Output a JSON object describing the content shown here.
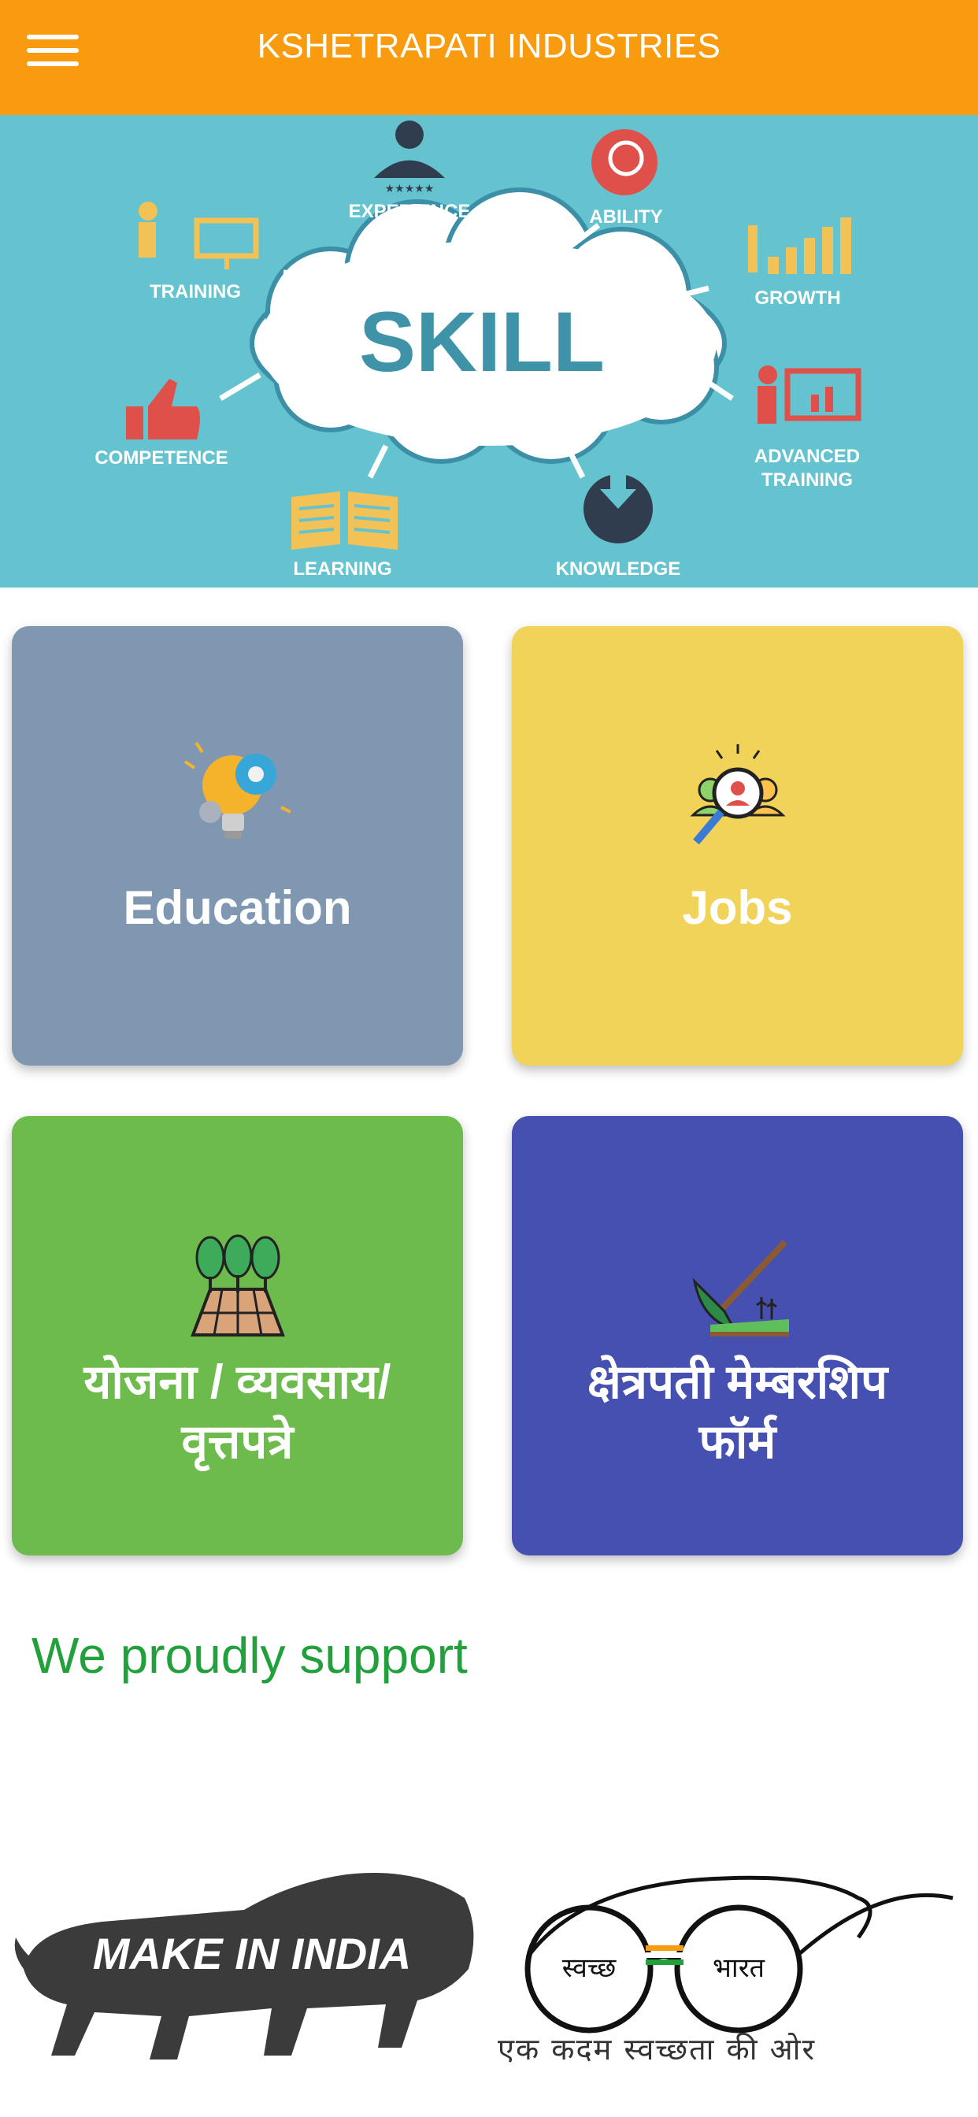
{
  "appbar": {
    "title": "KSHETRAPATI INDUSTRIES",
    "menu_icon": "hamburger-menu-icon",
    "background_color": "#f99b0f"
  },
  "banner": {
    "center_word": "SKILL",
    "labels": {
      "experience": "EXPERIENCE",
      "ability": "ABILITY",
      "training": "TRAINING",
      "growth": "GROWTH",
      "competence": "COMPETENCE",
      "advanced_line1": "ADVANCED",
      "advanced_line2": "TRAINING",
      "learning": "LEARNING",
      "knowledge": "KNOWLEDGE"
    },
    "background_color": "#64c3cf"
  },
  "tiles": [
    {
      "label": "Education",
      "icon": "lightbulb-gears-icon",
      "color": "#8097b2"
    },
    {
      "label": "Jobs",
      "icon": "job-search-icon",
      "color": "#f1d359"
    },
    {
      "label_line1": "योजना / व्यवसाय/",
      "label_line2": "वृत्तपत्रे",
      "icon": "farm-trees-icon",
      "color": "#6dbb4c"
    },
    {
      "label_line1": "क्षेत्रपती मेम्बरशिप",
      "label_line2": "फॉर्म",
      "icon": "hoe-crop-icon",
      "color": "#4550b0"
    }
  ],
  "support": {
    "heading": "We proudly support",
    "make_in_india": "MAKE IN INDIA",
    "swachh_left": "स्वच्छ",
    "swachh_right": "भारत",
    "swachh_tagline": "एक कदम स्वच्छता की ओर"
  }
}
